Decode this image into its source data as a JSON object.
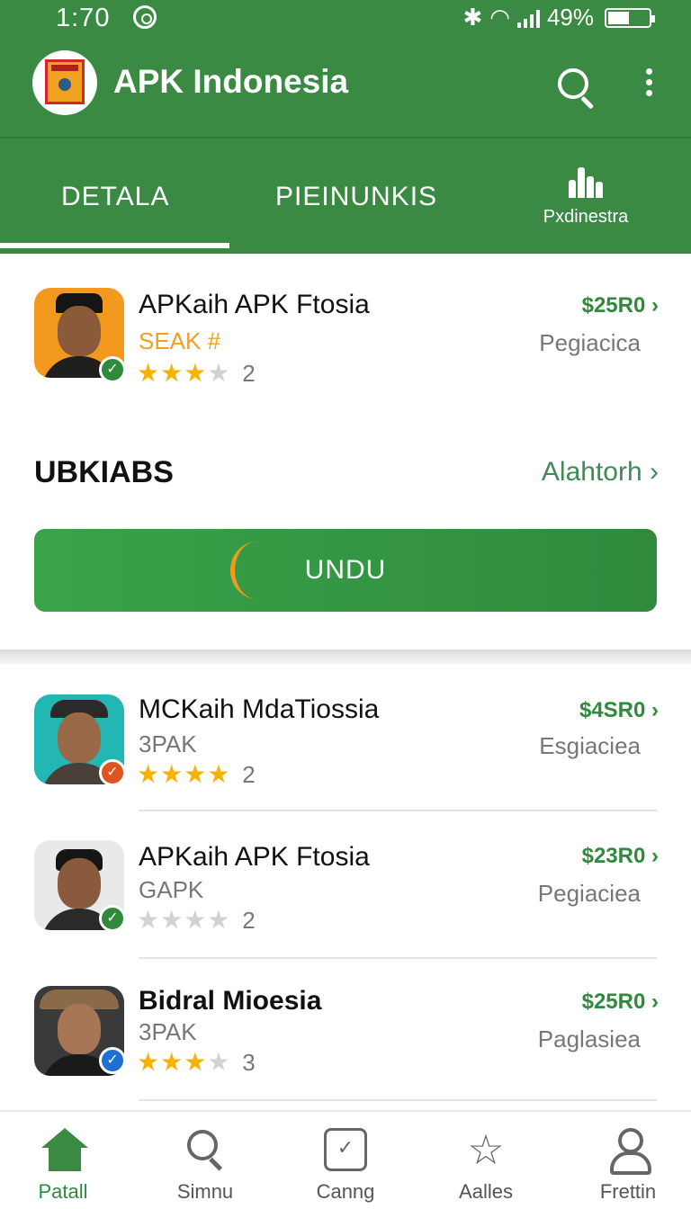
{
  "status_bar": {
    "time": "1:70",
    "battery": "49%"
  },
  "app_bar": {
    "title": "APK Indonesia"
  },
  "tabs": [
    {
      "label": "DETALA"
    },
    {
      "label": "PIEINUNKIS"
    },
    {
      "label": "Pxdinestra"
    }
  ],
  "featured": {
    "title": "APKaih APK Ftosia",
    "subtitle": "SEAK #",
    "rating": 2.5,
    "rating_count": "2",
    "price": "$25R0",
    "category": "Pegiacica"
  },
  "section": {
    "title": "UBKIABS",
    "link": "Alahtorh"
  },
  "cta": {
    "label": "UNDU"
  },
  "apps": [
    {
      "title": "MCKaih MdaTiossia",
      "subtitle": "3PAK",
      "rating": 4,
      "rating_count": "2",
      "price": "$4SR0",
      "category": "Esgiacieа",
      "badge_color": "#e0521e"
    },
    {
      "title": "APKaih APK Ftosia",
      "subtitle": "GAPK",
      "rating": 0,
      "rating_count": "2",
      "price": "$23R0",
      "category": "Pegiaciea",
      "badge_color": "#2f8a3c"
    },
    {
      "title": "Bidral Mioesia",
      "subtitle": "3PAK",
      "rating": 2.5,
      "rating_count": "3",
      "price": "$25R0",
      "category": "Paglasiea",
      "badge_color": "#1e6fd0"
    }
  ],
  "bottom_nav": [
    {
      "label": "Patall",
      "icon": "home-icon"
    },
    {
      "label": "Simnu",
      "icon": "search-icon"
    },
    {
      "label": "Canng",
      "icon": "cart-icon"
    },
    {
      "label": "Aalles",
      "icon": "star-icon"
    },
    {
      "label": "Frettin",
      "icon": "user-icon"
    }
  ]
}
